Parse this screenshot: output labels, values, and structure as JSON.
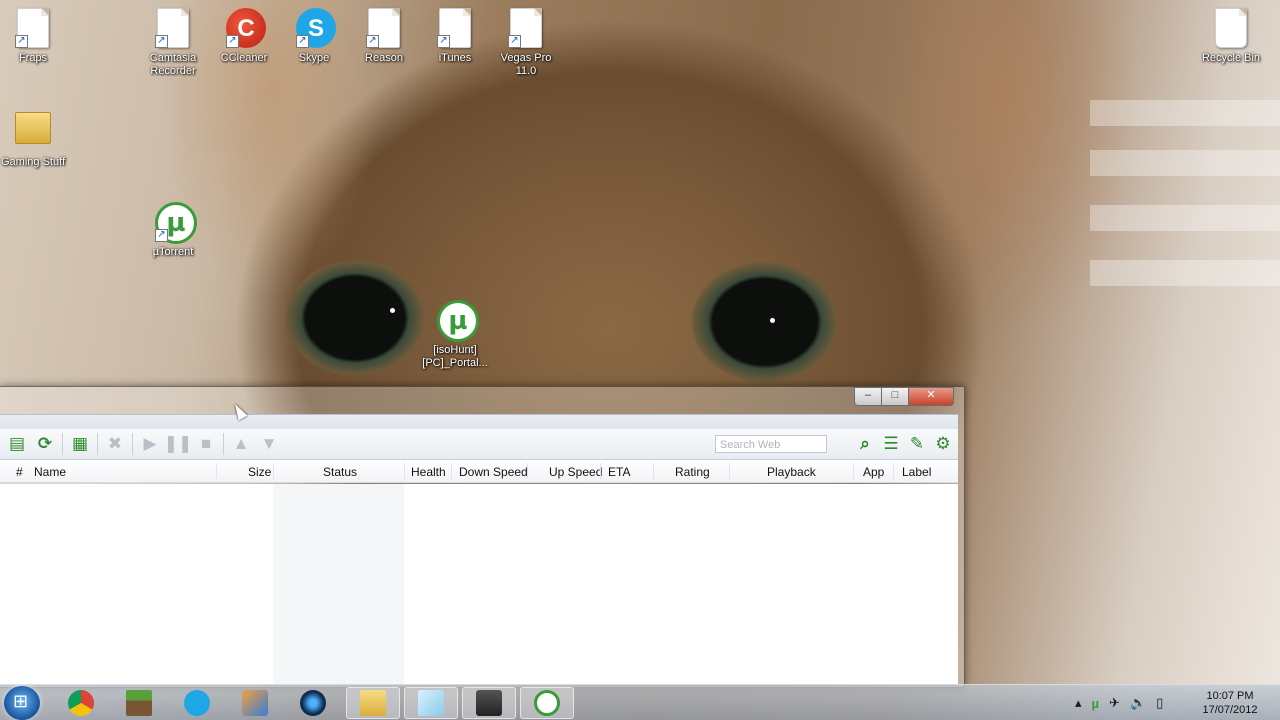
{
  "desktop": {
    "icons": [
      {
        "label": "Fraps",
        "icon": "document-shortcut-icon"
      },
      {
        "label": "Camtasia Recorder",
        "icon": "document-shortcut-icon"
      },
      {
        "label": "CCleaner",
        "icon": "ccleaner-icon"
      },
      {
        "label": "Skype",
        "icon": "skype-icon"
      },
      {
        "label": "Reason",
        "icon": "document-shortcut-icon"
      },
      {
        "label": "iTunes",
        "icon": "document-shortcut-icon"
      },
      {
        "label": "Vegas Pro 11.0",
        "icon": "document-shortcut-icon"
      },
      {
        "label": "Recycle Bin",
        "icon": "recycle-bin-icon"
      },
      {
        "label": "Gaming Stuff",
        "icon": "folder-icon"
      },
      {
        "label": "µTorrent",
        "icon": "utorrent-icon"
      },
      {
        "label": "[isoHunt] [PC]_Portal...",
        "icon": "utorrent-file-icon"
      }
    ]
  },
  "window": {
    "controls": {
      "minimize": "–",
      "maximize": "□",
      "close": "✕"
    },
    "toolbar": {
      "search_placeholder": "Search Web",
      "icons": [
        "add-torrent-icon",
        "add-url-icon",
        "create-torrent-icon",
        "remove-icon",
        "start-icon",
        "pause-icon",
        "stop-icon",
        "move-up-icon",
        "move-down-icon",
        "search-icon",
        "list-view-icon",
        "remote-icon",
        "settings-icon"
      ]
    },
    "columns": [
      "#",
      "Name",
      "Size",
      "Status",
      "Health",
      "Down Speed",
      "Up Speed",
      "ETA",
      "Rating",
      "Playback",
      "App",
      "Label"
    ]
  },
  "taskbar": {
    "apps": [
      "chrome-icon",
      "minecraft-icon",
      "skype-icon",
      "paint-icon",
      "media-center-icon",
      "explorer-icon",
      "notepad-icon",
      "camera-icon",
      "utorrent-icon"
    ],
    "clock": {
      "time": "10:07 PM",
      "date": "17/07/2012"
    }
  },
  "colors": {
    "utorrent_green": "#3a9b3a",
    "taskbar": "#a8b3c0",
    "close_button": "#c7432a"
  }
}
